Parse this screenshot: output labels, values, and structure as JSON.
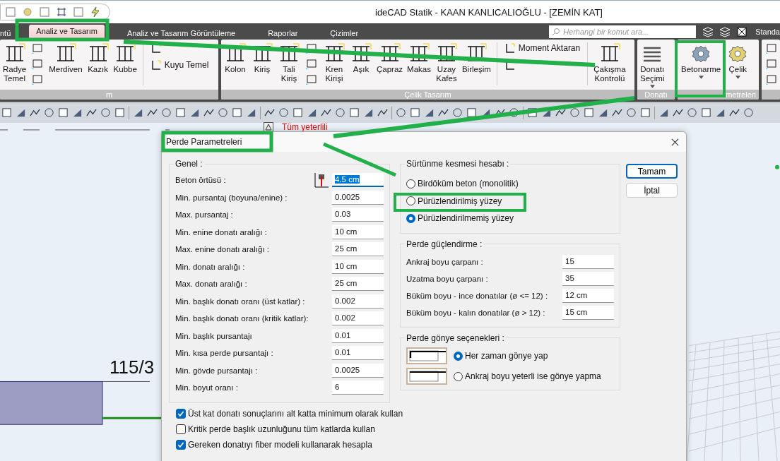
{
  "window": {
    "title": "ideCAD Statik - KAAN KANLICALIOĞLU - [ZEMİN KAT]"
  },
  "tabs": [
    {
      "label": "ntü",
      "selected": false
    },
    {
      "label": "Analiz ve Tasarım",
      "selected": true
    },
    {
      "label": "Analiz ve Tasarım Görüntüleme",
      "selected": false
    },
    {
      "label": "Raporlar",
      "selected": false
    },
    {
      "label": "Çizimler",
      "selected": false
    }
  ],
  "search": {
    "placeholder": "Herhangi bir komut ara..."
  },
  "style_label": "Standa",
  "ribbon": [
    {
      "label": "m",
      "items": [
        {
          "kind": "large",
          "lines": [
            "Radye",
            "Temel"
          ]
        },
        {
          "kind": "icons"
        },
        {
          "kind": "large",
          "lines": [
            "Merdiven"
          ]
        },
        {
          "kind": "large",
          "lines": [
            "Kazık"
          ]
        },
        {
          "kind": "large",
          "lines": [
            "Kubbe"
          ]
        },
        {
          "kind": "separator"
        },
        {
          "kind": "small",
          "rows": [
            {
              "kind": "icon"
            },
            {
              "kind": "text",
              "label": "Kuyu Temel"
            }
          ]
        }
      ]
    },
    {
      "label": "Çelik Tasarım",
      "items": [
        {
          "kind": "large",
          "lines": [
            "Kolon"
          ]
        },
        {
          "kind": "large",
          "lines": [
            "Kiriş"
          ]
        },
        {
          "kind": "large",
          "lines": [
            "Tali",
            "Kiriş"
          ]
        },
        {
          "kind": "icons"
        },
        {
          "kind": "large",
          "lines": [
            "Kren",
            "Kirişi"
          ]
        },
        {
          "kind": "large",
          "lines": [
            "Aşık"
          ]
        },
        {
          "kind": "large",
          "lines": [
            "Çapraz"
          ]
        },
        {
          "kind": "large",
          "lines": [
            "Makas"
          ]
        },
        {
          "kind": "large",
          "lines": [
            "Uzay",
            "Kafes"
          ]
        },
        {
          "kind": "large",
          "lines": [
            "Birleşim"
          ]
        },
        {
          "kind": "separator"
        },
        {
          "kind": "small",
          "rows": [
            {
              "kind": "text",
              "label": "Moment Aktaran"
            },
            {
              "kind": "icon"
            }
          ]
        },
        {
          "kind": "separator"
        },
        {
          "kind": "large",
          "lines": [
            "Çakışma",
            "Kontrolü"
          ]
        }
      ]
    },
    {
      "label": "Donatı",
      "items": [
        {
          "kind": "large",
          "lines": [
            "Donatı",
            "Seçimi"
          ],
          "dropdown": true
        }
      ]
    },
    {
      "label": "metreleri",
      "items": [
        {
          "kind": "large",
          "lines": [
            "Betonarme"
          ],
          "dropdown": true
        },
        {
          "kind": "large",
          "lines": [
            "Çelik"
          ],
          "dropdown": true
        }
      ]
    },
    {
      "items": [
        {
          "kind": "icons"
        }
      ]
    }
  ],
  "canvas": {
    "notice": "Tüm yeterlili",
    "dimension": "115/3"
  },
  "dialog": {
    "title": "Perde Parametreleri",
    "general": {
      "title": "Genel :",
      "fields": [
        {
          "label": "Beton örtüsü :",
          "value": "4.5 cm",
          "focused": true
        },
        {
          "label": "Min.  pursantaj (boyuna/enine) :",
          "value": "0.0025",
          "focused": false
        },
        {
          "label": "Max. pursantaj :",
          "value": "0.03",
          "focused": false
        },
        {
          "label": "Min. enine donatı aralığı :",
          "value": "10 cm",
          "focused": false
        },
        {
          "label": "Max. enine donatı aralığı :",
          "value": "25 cm",
          "focused": false
        },
        {
          "label": "Min. donatı aralığı :",
          "value": "10 cm",
          "focused": false
        },
        {
          "label": "Max. donatı aralığı :",
          "value": "25 cm",
          "focused": false
        },
        {
          "label": "Min. başlık donatı oranı (üst katlar) :",
          "value": "0.002",
          "focused": false
        },
        {
          "label": "Min. başlık donatı oranı (kritik katlar):",
          "value": "0.002",
          "focused": false
        },
        {
          "label": "Min. başlık pursantajı",
          "value": "0.01",
          "focused": false
        },
        {
          "label": "Min. kısa perde pursantajı :",
          "value": "0.01",
          "focused": false
        },
        {
          "label": "Min. gövde pursantajı :",
          "value": "0.0025",
          "focused": false
        },
        {
          "label": "Min. boyut oranı :",
          "value": "6",
          "focused": false
        }
      ]
    },
    "checkboxes": [
      {
        "label": "Üst kat donatı sonuçlarını alt katta minimum olarak kullan",
        "checked": true
      },
      {
        "label": "Kritik perde başlık uzunluğunu tüm katlarda kullan",
        "checked": false
      },
      {
        "label": "Gereken donatıyı fiber modeli kullanarak hesapla",
        "checked": true
      }
    ],
    "friction": {
      "title": "Sürtünme kesmesi hesabı :",
      "options": [
        {
          "label": "Birdöküm beton (monolitik)",
          "selected": false
        },
        {
          "label": "Pürüzlendirilmiş yüzey",
          "selected": false
        },
        {
          "label": "Pürüzlendirilmemiş yüzey",
          "selected": true
        }
      ]
    },
    "strengthening": {
      "title": "Perde güçlendirme :",
      "fields": [
        {
          "label": "Ankraj boyu çarpanı :",
          "value": "15"
        },
        {
          "label": "Uzatma boyu çarpanı :",
          "value": "35"
        },
        {
          "label": "Büküm boyu - ince donatılar (ø <= 12) :",
          "value": "12 cm"
        },
        {
          "label": "Büküm boyu - kalın donatılar (ø > 12) :",
          "value": "15 cm"
        }
      ]
    },
    "miter": {
      "title": "Perde gönye seçenekleri :",
      "options": [
        {
          "label": "Her zaman gönye yap",
          "selected": true
        },
        {
          "label": "Ankraj boyu yeterli ise gönye yapma",
          "selected": false
        }
      ]
    },
    "buttons": [
      {
        "label": "Tamam",
        "default": true
      },
      {
        "label": "İptal",
        "default": false
      }
    ]
  }
}
